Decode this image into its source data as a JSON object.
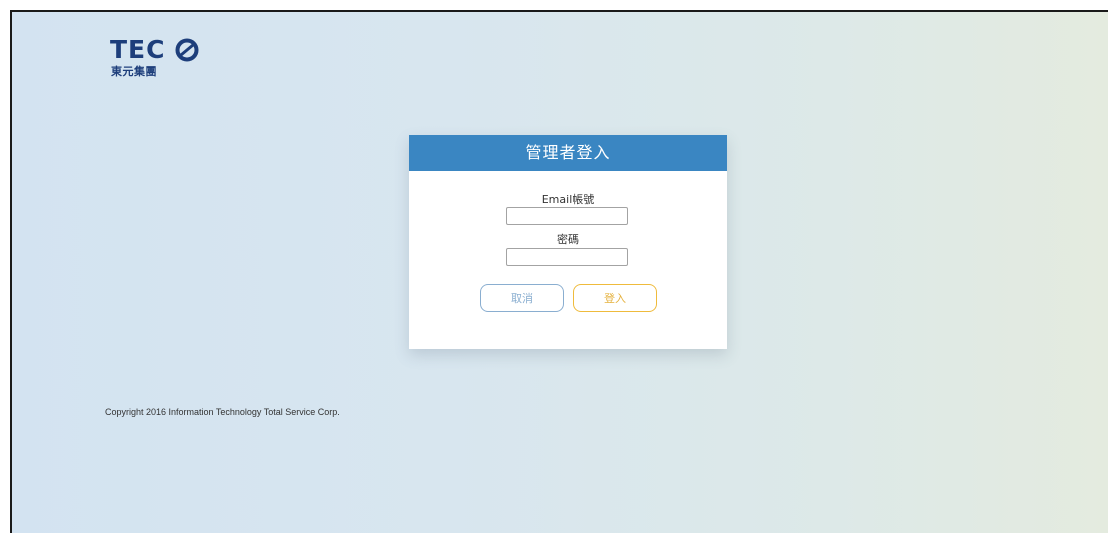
{
  "brand": {
    "logo_main": "TECO",
    "logo_sub": "東元集團",
    "color": "#1d3e7b"
  },
  "login": {
    "title": "管理者登入",
    "email_label": "Email帳號",
    "email_value": "",
    "password_label": "密碼",
    "password_value": "",
    "cancel_label": "取消",
    "submit_label": "登入"
  },
  "footer": {
    "copyright": "Copyright 2016 Information Technology Total Service Corp."
  },
  "colors": {
    "header_blue": "#3a86c2",
    "cancel_border": "#8aaed0",
    "submit_border": "#efbb3c"
  },
  "icons": {
    "logo_emblem": "teco-emblem-icon"
  }
}
